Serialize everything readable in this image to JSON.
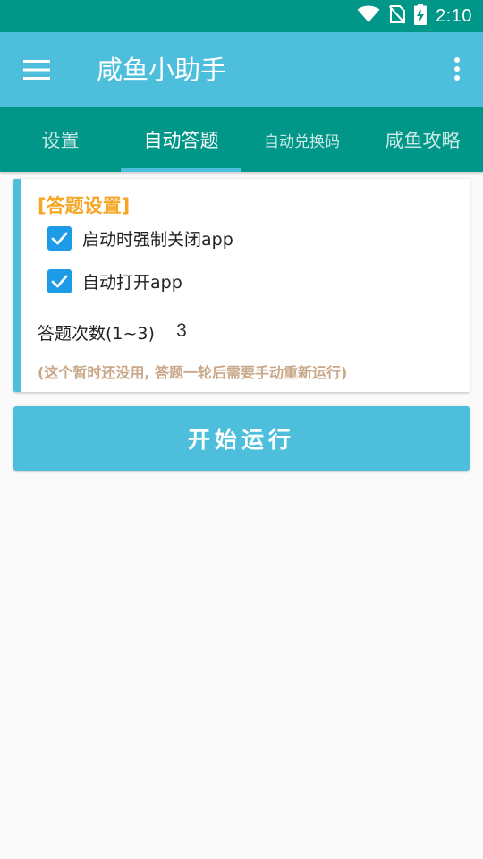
{
  "status_bar": {
    "time": "2:10",
    "icons": [
      "wifi-icon",
      "no-sim-icon",
      "battery-charging-icon"
    ],
    "color": "#009688"
  },
  "app_bar": {
    "title": "咸鱼小助手",
    "menu_icon": "hamburger-menu-icon",
    "more_icon": "more-vert-icon",
    "color": "#4dbfdd"
  },
  "tabs": [
    {
      "label": "设置",
      "active": false
    },
    {
      "label": "自动答题",
      "active": true
    },
    {
      "label": "自动兑换码",
      "active": false
    },
    {
      "label": "咸鱼攻略",
      "active": false
    }
  ],
  "settings_card": {
    "title": "[答题设置]",
    "options": [
      {
        "label": "启动时强制关闭app",
        "checked": true
      },
      {
        "label": "自动打开app",
        "checked": true
      }
    ],
    "count_label": "答题次数(1~3)",
    "count_value": "3",
    "note": "(这个暂时还没用, 答题一轮后需要手动重新运行)"
  },
  "run_button": {
    "label": "开始运行"
  },
  "colors": {
    "accent": "#4dbfdd",
    "primary_dark": "#009688",
    "checkbox": "#1e9be6",
    "section_title": "#f5a623",
    "note": "#c8a888"
  }
}
